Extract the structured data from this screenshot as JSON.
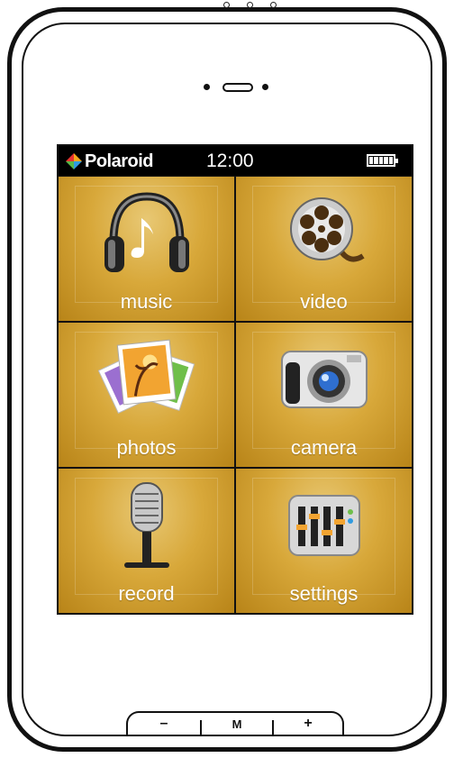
{
  "status_bar": {
    "brand": "Polaroid",
    "time": "12:00",
    "battery_level": 1.0
  },
  "tiles": [
    {
      "label": "music",
      "icon": "headphones-icon"
    },
    {
      "label": "video",
      "icon": "film-reel-icon"
    },
    {
      "label": "photos",
      "icon": "photos-icon"
    },
    {
      "label": "camera",
      "icon": "camera-icon"
    },
    {
      "label": "record",
      "icon": "microphone-icon"
    },
    {
      "label": "settings",
      "icon": "equalizer-icon"
    }
  ],
  "hardware_buttons": {
    "minus": "–",
    "menu": "M",
    "plus": "+"
  },
  "colors": {
    "tile_gold": "#d8a83a",
    "status_bar": "#000000"
  }
}
